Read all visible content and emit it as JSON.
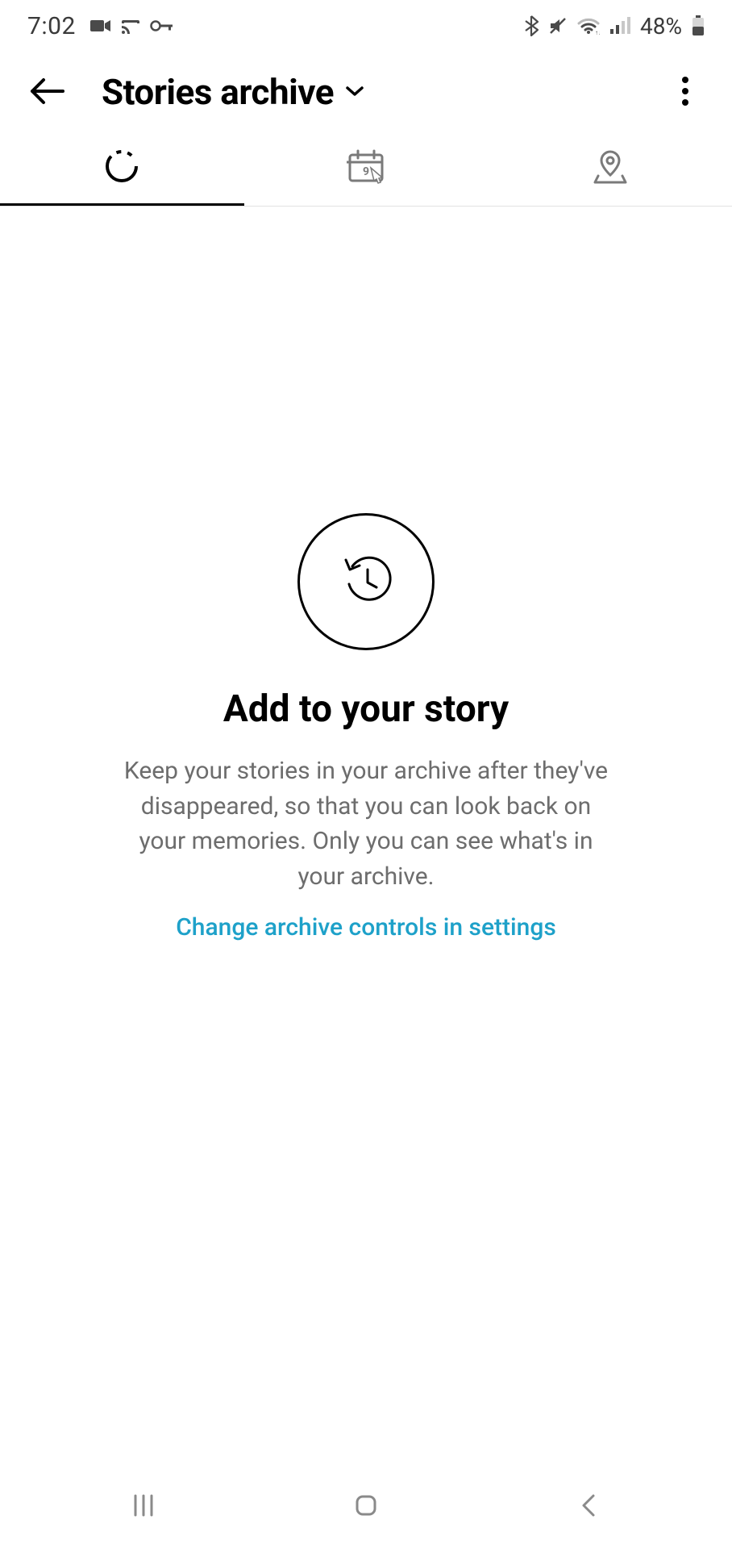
{
  "status": {
    "time": "7:02",
    "battery_pct": "48%"
  },
  "header": {
    "title": "Stories archive"
  },
  "empty": {
    "title": "Add to your story",
    "description": "Keep your stories in your archive after they've disappeared, so that you can look back on your memories. Only you can see what's in your archive.",
    "link": "Change archive controls in settings"
  }
}
